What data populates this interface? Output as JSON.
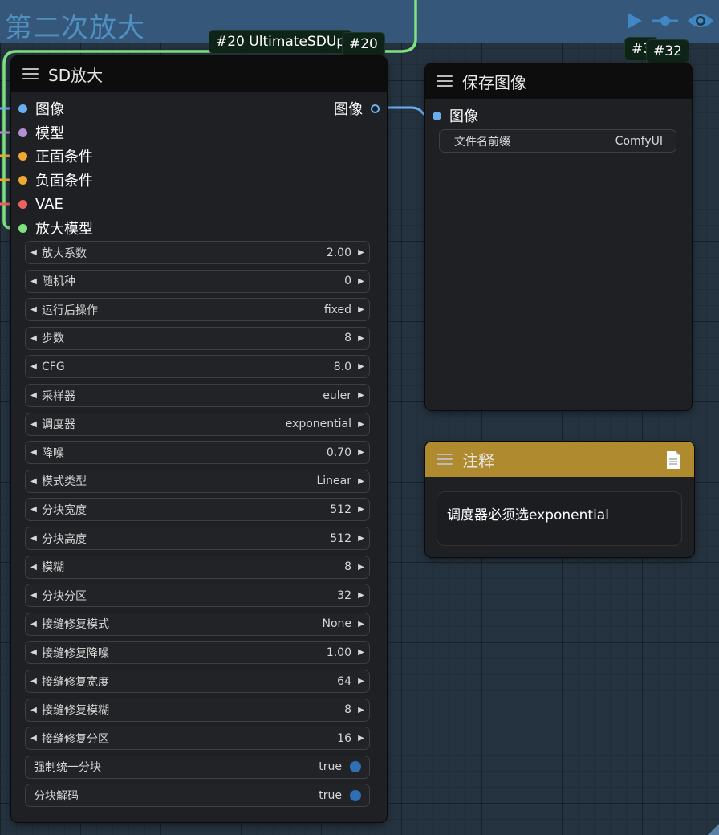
{
  "group": {
    "title": "第二次放大"
  },
  "badges": {
    "upscale_title": "#20 UltimateSDUp",
    "upscale_id": "#20",
    "save_title": "#3",
    "save_id": "#32"
  },
  "upscale_node": {
    "title": "SD放大",
    "inputs": [
      {
        "label": "图像",
        "color": "#6aaef0"
      },
      {
        "label": "模型",
        "color": "#b48fd6"
      },
      {
        "label": "正面条件",
        "color": "#f0a830"
      },
      {
        "label": "负面条件",
        "color": "#f0a830"
      },
      {
        "label": "VAE",
        "color": "#ef6060"
      },
      {
        "label": "放大模型",
        "color": "#7ee27e"
      }
    ],
    "output": {
      "label": "图像",
      "color": "#6aaef0"
    },
    "widgets": [
      {
        "label": "放大系数",
        "value": "2.00"
      },
      {
        "label": "随机种",
        "value": "0"
      },
      {
        "label": "运行后操作",
        "value": "fixed"
      },
      {
        "label": "步数",
        "value": "8"
      },
      {
        "label": "CFG",
        "value": "8.0"
      },
      {
        "label": "采样器",
        "value": "euler"
      },
      {
        "label": "调度器",
        "value": "exponential"
      },
      {
        "label": "降噪",
        "value": "0.70"
      },
      {
        "label": "模式类型",
        "value": "Linear"
      },
      {
        "label": "分块宽度",
        "value": "512"
      },
      {
        "label": "分块高度",
        "value": "512"
      },
      {
        "label": "模糊",
        "value": "8"
      },
      {
        "label": "分块分区",
        "value": "32"
      },
      {
        "label": "接缝修复模式",
        "value": "None"
      },
      {
        "label": "接缝修复降噪",
        "value": "1.00"
      },
      {
        "label": "接缝修复宽度",
        "value": "64"
      },
      {
        "label": "接缝修复模糊",
        "value": "8"
      },
      {
        "label": "接缝修复分区",
        "value": "16"
      }
    ],
    "toggles": [
      {
        "label": "强制统一分块",
        "value": "true"
      },
      {
        "label": "分块解码",
        "value": "true"
      }
    ]
  },
  "save_node": {
    "title": "保存图像",
    "input": {
      "label": "图像",
      "color": "#6aaef0"
    },
    "filename_label": "文件名前缀",
    "filename_value": "ComfyUI"
  },
  "note_node": {
    "title": "注释",
    "text": "调度器必须选exponential"
  },
  "icons": [
    "play-icon",
    "link-icon",
    "eye-icon",
    "menu-icon",
    "document-icon",
    "arrow-left-icon",
    "arrow-right-icon"
  ],
  "colors": {
    "accent_green": "#7ee27e",
    "link_blue": "#6aaef0",
    "note_header": "#b08a2e",
    "group_band": "#35577a"
  }
}
